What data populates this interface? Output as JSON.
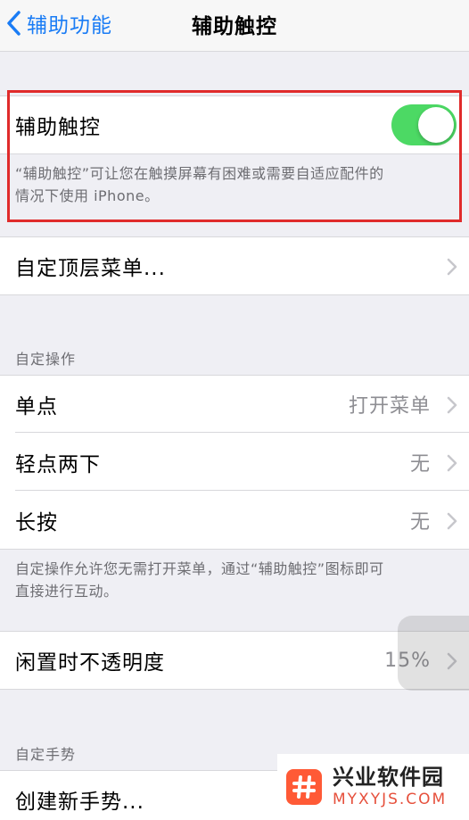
{
  "nav": {
    "back_label": "辅助功能",
    "title": "辅助触控"
  },
  "assistive_touch": {
    "label": "辅助触控",
    "enabled": true,
    "accent_color": "#4cd964",
    "footnote_line1": "“辅助触控”可让您在触摸屏幕有困难或需要自适应配件的",
    "footnote_line2": "情况下使用 iPhone。"
  },
  "top_menu": {
    "label": "自定顶层菜单..."
  },
  "custom_actions": {
    "header": "自定操作",
    "items": [
      {
        "label": "单点",
        "value": "打开菜单"
      },
      {
        "label": "轻点两下",
        "value": "无"
      },
      {
        "label": "长按",
        "value": "无"
      }
    ],
    "footnote_line1": "自定操作允许您无需打开菜单，通过“辅助触控”图标即可",
    "footnote_line2": "直接进行互动。"
  },
  "idle_opacity": {
    "label": "闲置时不透明度",
    "value": "15%"
  },
  "custom_gestures": {
    "header": "自定手势",
    "create_label": "创建新手势..."
  },
  "watermark": {
    "name": "兴业软件园",
    "domain": "MYXYJS.COM"
  }
}
